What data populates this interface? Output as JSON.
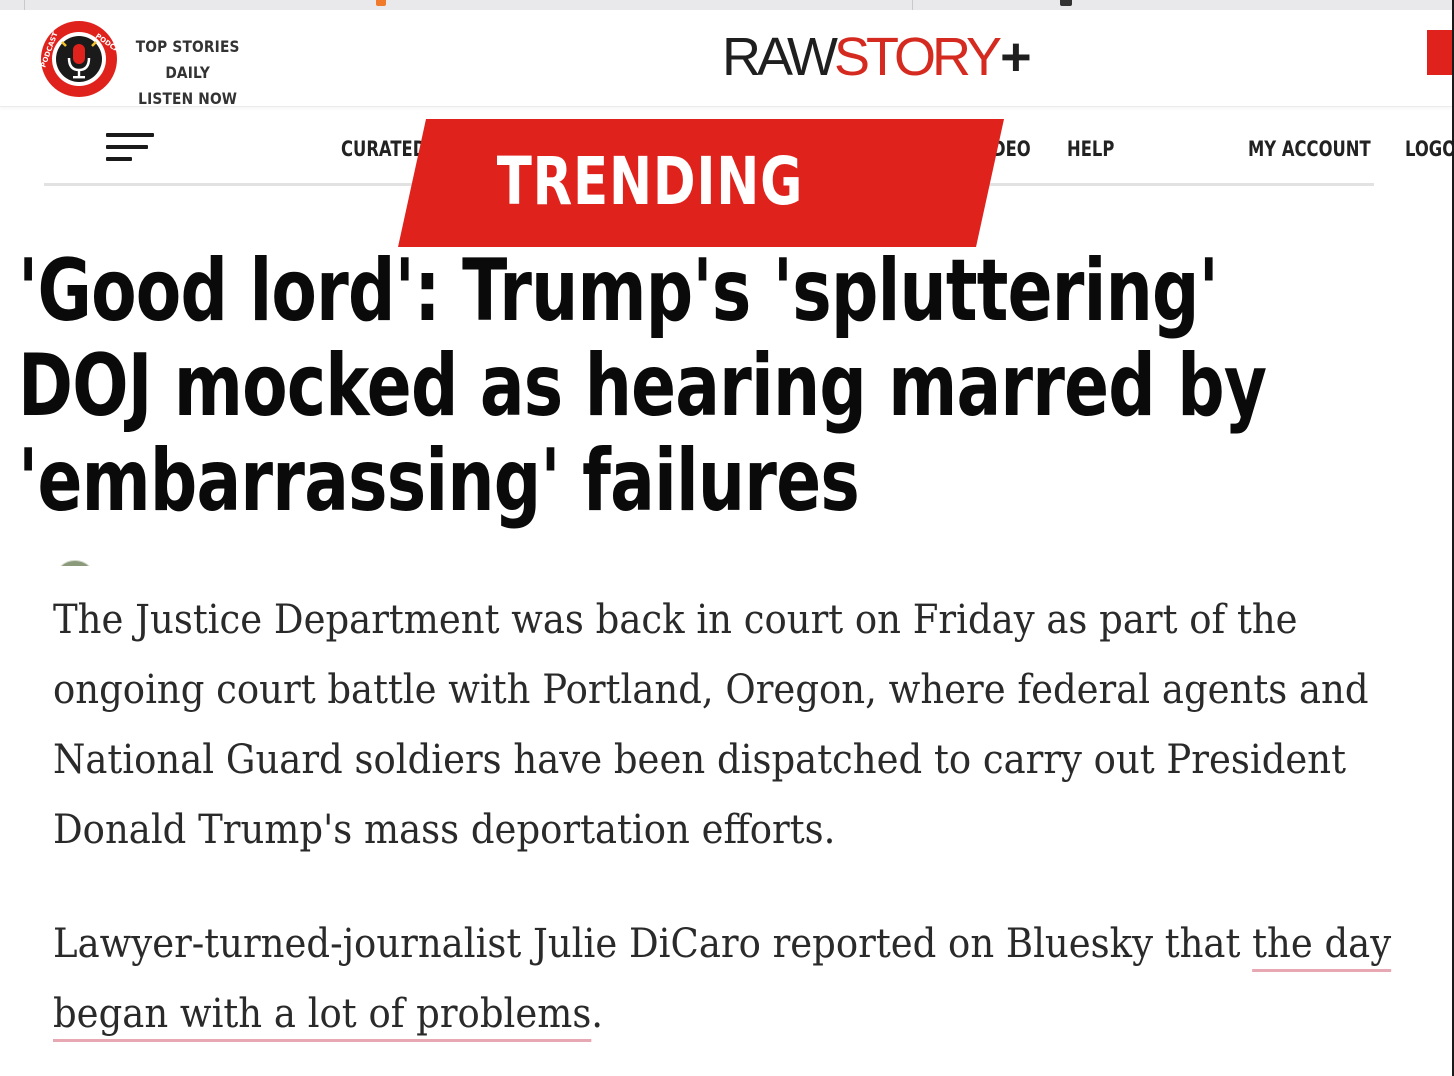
{
  "header": {
    "podcast_line1": "TOP STORIES DAILY",
    "podcast_line2": "LISTEN NOW",
    "podcast_badge_text": "PODCAST",
    "logo_raw": "RAW",
    "logo_story": "STORY",
    "logo_plus": "+"
  },
  "nav": {
    "items": [
      {
        "label": "CURATED"
      },
      {
        "label": "DEO"
      },
      {
        "label": "HELP"
      },
      {
        "label": "MY ACCOUNT"
      },
      {
        "label": "LOGO"
      }
    ]
  },
  "trending": {
    "label": "TRENDING"
  },
  "article": {
    "headline": "'Good lord': Trump's 'spluttering' DOJ mocked as hearing marred by 'embarrassing' failures",
    "paragraph1": "The Justice Department was back in court on Friday as part of the ongoing court battle with Portland, Oregon, where federal agents and National Guard soldiers have been dispatched to carry out President Donald Trump's mass deportation efforts.",
    "paragraph2_prefix": "Lawyer-turned-journalist Julie DiCaro reported on Bluesky that ",
    "paragraph2_link": "the day began with a lot of problems",
    "paragraph2_suffix": "."
  },
  "colors": {
    "brand_red": "#e0221d",
    "logo_red": "#d42a1f",
    "link_underline": "#e8a8b3",
    "text_dark": "#0a0a0a"
  },
  "icons": {
    "podcast": "microphone-badge-icon",
    "menu": "hamburger-menu-icon"
  }
}
